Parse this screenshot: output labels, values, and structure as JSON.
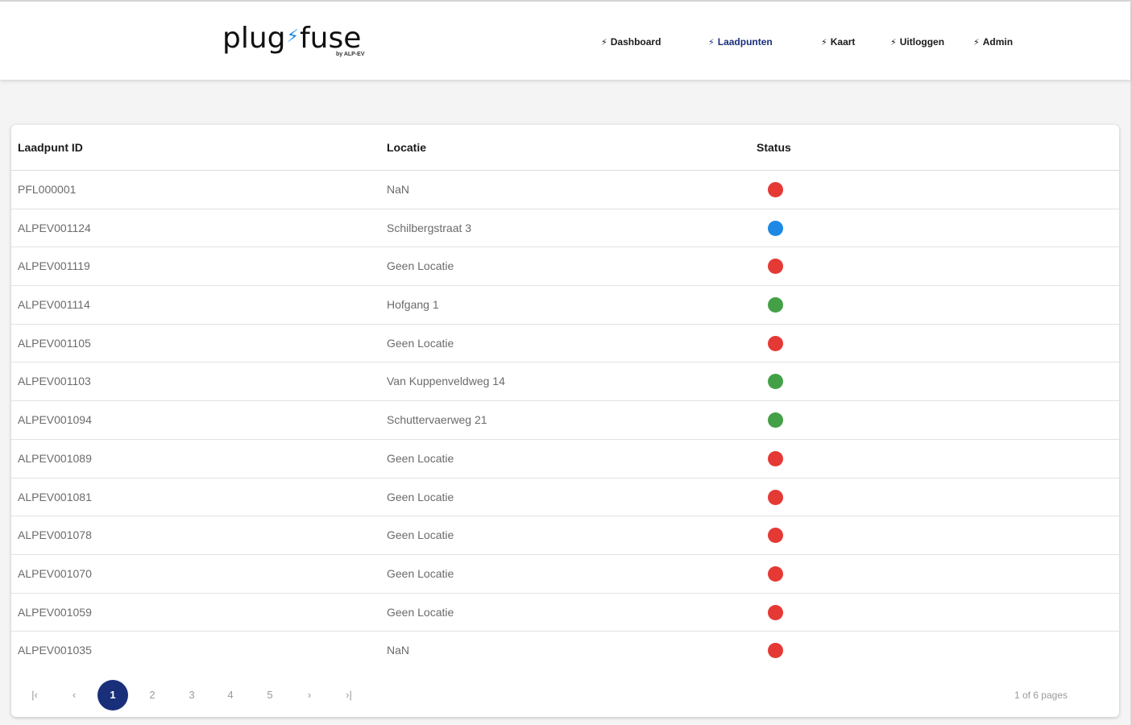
{
  "header": {
    "logo_main_left": "plug",
    "logo_main_right": "fuse",
    "logo_sub": "by ALP-EV",
    "nav": [
      {
        "label": "Dashboard",
        "active": false
      },
      {
        "label": "Laadpunten",
        "active": true
      },
      {
        "label": "Kaart",
        "active": false
      },
      {
        "label": "Uitloggen",
        "active": false
      },
      {
        "label": "Admin",
        "active": false
      }
    ]
  },
  "table": {
    "columns": [
      "Laadpunt ID",
      "Locatie",
      "Status"
    ],
    "rows": [
      {
        "id": "PFL000001",
        "locatie": "NaN",
        "status": "red"
      },
      {
        "id": "ALPEV001124",
        "locatie": "Schilbergstraat 3",
        "status": "blue"
      },
      {
        "id": "ALPEV001119",
        "locatie": "Geen Locatie",
        "status": "red"
      },
      {
        "id": "ALPEV001114",
        "locatie": "Hofgang 1",
        "status": "green"
      },
      {
        "id": "ALPEV001105",
        "locatie": "Geen Locatie",
        "status": "red"
      },
      {
        "id": "ALPEV001103",
        "locatie": "Van Kuppenveldweg 14",
        "status": "green"
      },
      {
        "id": "ALPEV001094",
        "locatie": "Schuttervaerweg 21",
        "status": "green"
      },
      {
        "id": "ALPEV001089",
        "locatie": "Geen Locatie",
        "status": "red"
      },
      {
        "id": "ALPEV001081",
        "locatie": "Geen Locatie",
        "status": "red"
      },
      {
        "id": "ALPEV001078",
        "locatie": "Geen Locatie",
        "status": "red"
      },
      {
        "id": "ALPEV001070",
        "locatie": "Geen Locatie",
        "status": "red"
      },
      {
        "id": "ALPEV001059",
        "locatie": "Geen Locatie",
        "status": "red"
      },
      {
        "id": "ALPEV001035",
        "locatie": "NaN",
        "status": "red"
      }
    ]
  },
  "status_colors": {
    "red": "#e53935",
    "green": "#43a047",
    "blue": "#1e88e5"
  },
  "pagination": {
    "first_icon": "first-page-icon",
    "prev_icon": "chevron-left-icon",
    "pages": [
      "1",
      "2",
      "3",
      "4",
      "5"
    ],
    "current": "1",
    "next_icon": "chevron-right-icon",
    "last_icon": "last-page-icon",
    "info": "1 of 6 pages"
  }
}
